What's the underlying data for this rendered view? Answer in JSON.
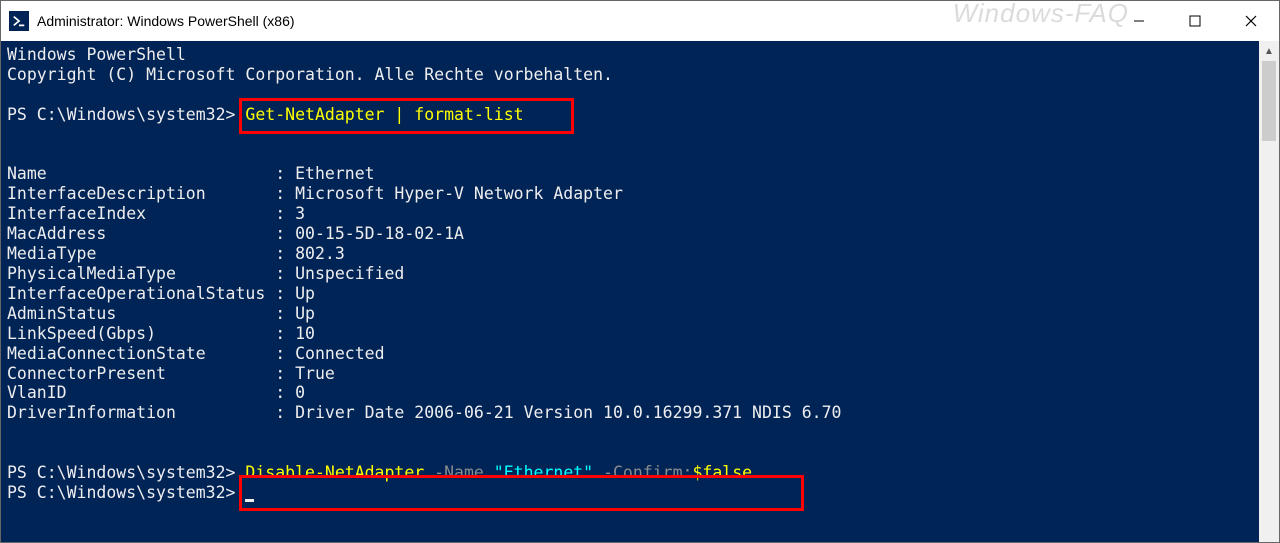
{
  "titlebar": {
    "title": "Administrator: Windows PowerShell (x86)",
    "watermark": "Windows-FAQ"
  },
  "console": {
    "header1": "Windows PowerShell",
    "header2": "Copyright (C) Microsoft Corporation. Alle Rechte vorbehalten.",
    "prompt": "PS C:\\Windows\\system32>",
    "cmd1": "Get-NetAdapter | format-list",
    "props": [
      {
        "k": "Name",
        "v": "Ethernet"
      },
      {
        "k": "InterfaceDescription",
        "v": "Microsoft Hyper-V Network Adapter"
      },
      {
        "k": "InterfaceIndex",
        "v": "3"
      },
      {
        "k": "MacAddress",
        "v": "00-15-5D-18-02-1A"
      },
      {
        "k": "MediaType",
        "v": "802.3"
      },
      {
        "k": "PhysicalMediaType",
        "v": "Unspecified"
      },
      {
        "k": "InterfaceOperationalStatus",
        "v": "Up"
      },
      {
        "k": "AdminStatus",
        "v": "Up"
      },
      {
        "k": "LinkSpeed(Gbps)",
        "v": "10"
      },
      {
        "k": "MediaConnectionState",
        "v": "Connected"
      },
      {
        "k": "ConnectorPresent",
        "v": "True"
      },
      {
        "k": "VlanID",
        "v": "0"
      },
      {
        "k": "DriverInformation",
        "v": "Driver Date 2006-06-21 Version 10.0.16299.371 NDIS 6.70"
      }
    ],
    "cmd2": {
      "cmd": "Disable-NetAdapter",
      "p1": " -Name ",
      "v1": "\"Ethernet\"",
      "p2": " -Confirm:",
      "v2": "$false"
    }
  }
}
